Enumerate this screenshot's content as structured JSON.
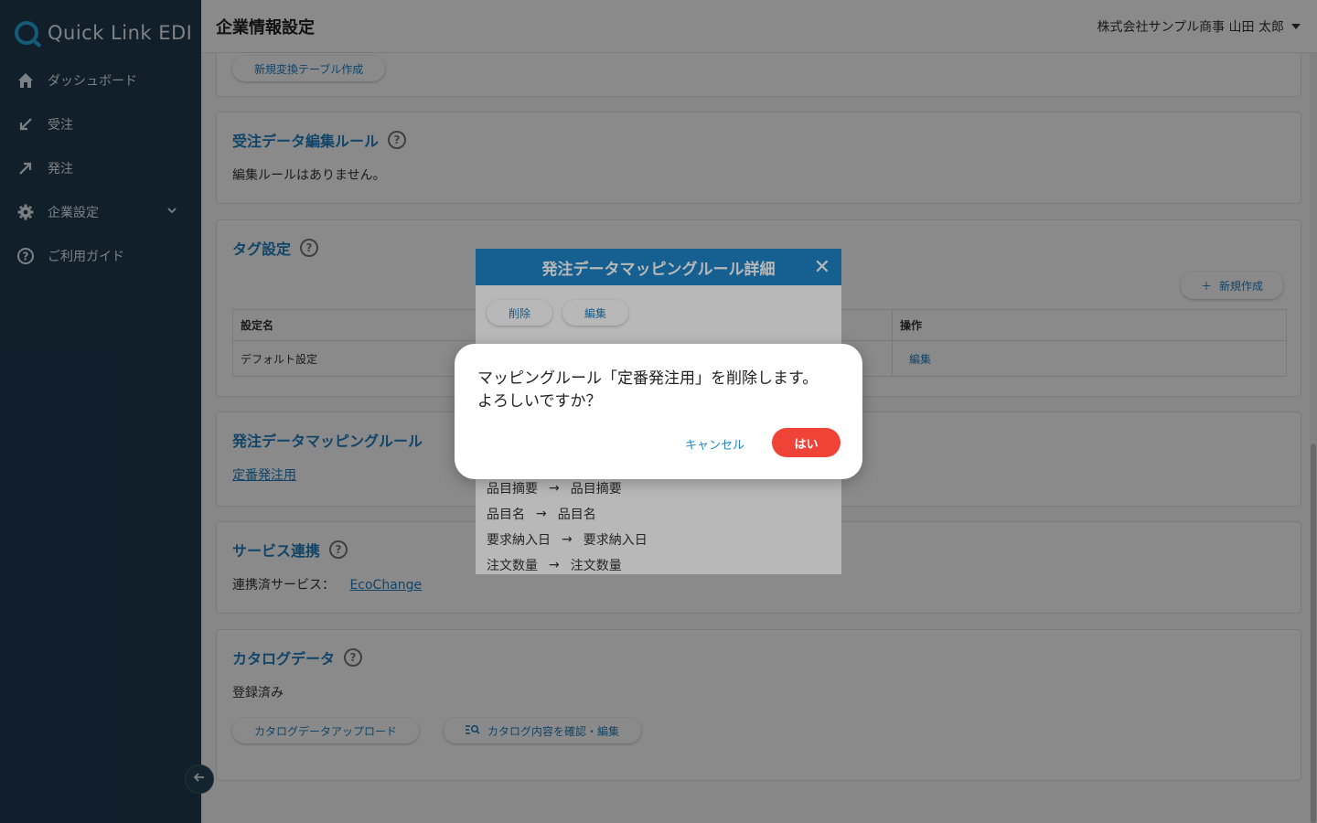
{
  "app": {
    "logo_text": "Quick Link EDI"
  },
  "sidebar": {
    "items": [
      {
        "label": "ダッシュボード",
        "icon": "home-icon"
      },
      {
        "label": "受注",
        "icon": "arrow-down-left-icon"
      },
      {
        "label": "発注",
        "icon": "arrow-up-right-icon"
      },
      {
        "label": "企業設定",
        "icon": "gear-icon"
      },
      {
        "label": "ご利用ガイド",
        "icon": "help-icon"
      }
    ]
  },
  "header": {
    "title": "企業情報設定",
    "user": "株式会社サンプル商事 山田 太郎"
  },
  "sections": {
    "conversion": {
      "button": "新規変換テーブル作成"
    },
    "order_edit_rules": {
      "title": "受注データ編集ルール",
      "empty": "編集ルールはありません。"
    },
    "tags": {
      "title": "タグ設定",
      "new_button": "新規作成",
      "columns": [
        "設定名",
        "操作"
      ],
      "rows": [
        {
          "name": "デフォルト設定",
          "action": "編集"
        }
      ]
    },
    "mapping_rules": {
      "title": "発注データマッピングルール",
      "link": "定番発注用"
    },
    "services": {
      "title": "サービス連携",
      "label": "連携済サービス：",
      "link": "EcoChange"
    },
    "catalog": {
      "title": "カタログデータ",
      "status": "登録済み",
      "upload_button": "カタログデータアップロード",
      "view_button": "カタログ内容を確認・編集"
    }
  },
  "mapping_dialog": {
    "title": "発注データマッピングルール詳細",
    "delete_button": "削除",
    "edit_button": "編集",
    "rows": [
      {
        "from": "品目摘要",
        "to": "品目摘要"
      },
      {
        "from": "品目名",
        "to": "品目名"
      },
      {
        "from": "要求納入日",
        "to": "要求納入日"
      },
      {
        "from": "注文数量",
        "to": "注文数量"
      }
    ]
  },
  "confirm_dialog": {
    "line1": "マッピングルール「定番発注用」を削除します。",
    "line2": "よろしいですか？",
    "cancel": "キャンセル",
    "confirm": "はい"
  },
  "colors": {
    "accent": "#1e86c8",
    "danger": "#f04338",
    "sidebar": "#1e3a4f"
  }
}
